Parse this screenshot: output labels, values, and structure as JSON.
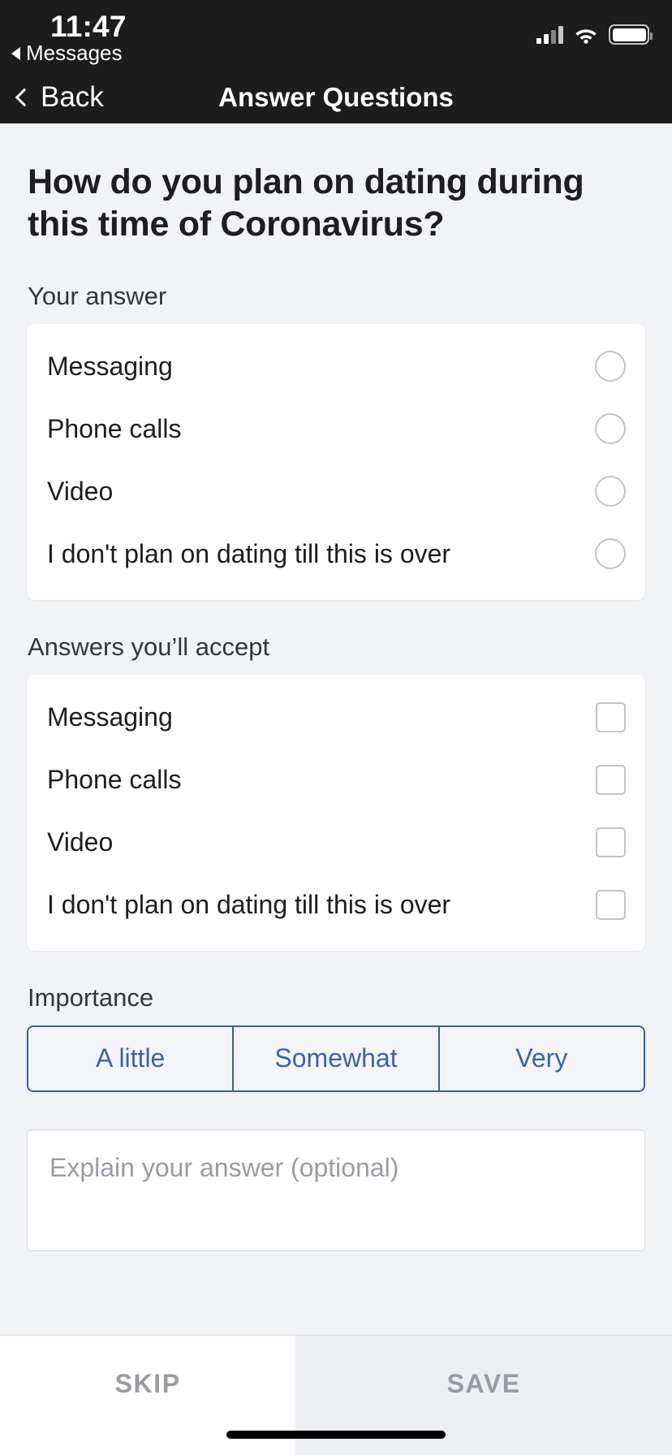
{
  "status_bar": {
    "time": "11:47",
    "return_app": "Messages",
    "icons": [
      "cellular-signal-icon",
      "wifi-icon",
      "battery-icon"
    ]
  },
  "nav_bar": {
    "back_label": "Back",
    "title": "Answer Questions",
    "back_icon": "chevron-left-icon"
  },
  "question": {
    "text": "How do you plan on dating during this time of Coronavirus?"
  },
  "your_answer": {
    "label": "Your answer",
    "control": "radio",
    "options": [
      {
        "label": "Messaging",
        "selected": false
      },
      {
        "label": "Phone calls",
        "selected": false
      },
      {
        "label": "Video",
        "selected": false
      },
      {
        "label": "I don't plan on dating till this is over",
        "selected": false
      }
    ]
  },
  "answers_accept": {
    "label": "Answers you’ll accept",
    "control": "checkbox",
    "options": [
      {
        "label": "Messaging",
        "checked": false
      },
      {
        "label": "Phone calls",
        "checked": false
      },
      {
        "label": "Video",
        "checked": false
      },
      {
        "label": "I don't plan on dating till this is over",
        "checked": false
      }
    ]
  },
  "importance": {
    "label": "Importance",
    "segments": [
      {
        "label": "A little",
        "selected": false
      },
      {
        "label": "Somewhat",
        "selected": false
      },
      {
        "label": "Very",
        "selected": false
      }
    ]
  },
  "explain": {
    "placeholder": "Explain your answer (optional)",
    "value": ""
  },
  "bottom_bar": {
    "skip_label": "SKIP",
    "save_label": "SAVE"
  },
  "colors": {
    "page_background": "#f2f3f7",
    "bar_background": "#1c1c1c",
    "card_background": "#ffffff",
    "accent_blue": "#3b63ad",
    "segment_border": "#3b5c9e",
    "muted_text": "#9a9ba3",
    "control_border": "#c3c4cb"
  }
}
